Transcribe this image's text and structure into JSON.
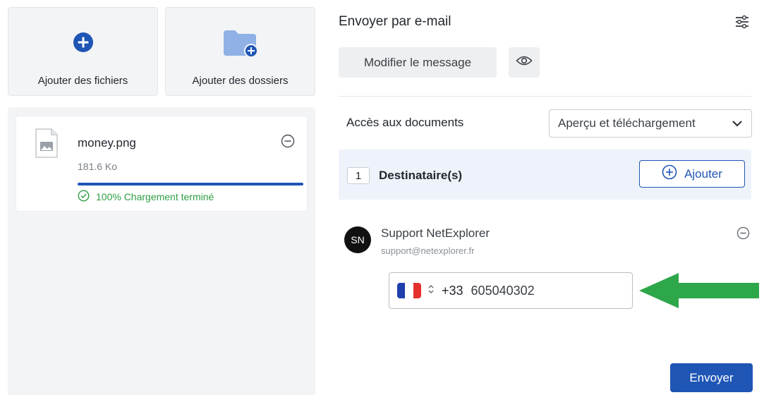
{
  "left": {
    "tiles": [
      {
        "label": "Ajouter des fichiers",
        "icon": "plus-circle-icon"
      },
      {
        "label": "Ajouter des dossiers",
        "icon": "folder-add-icon"
      }
    ],
    "file": {
      "name": "money.png",
      "size": "181.6 Ko",
      "progress": 1.0,
      "status": "100% Chargement terminé",
      "thumbnail_icon": "image-file-icon",
      "remove_icon": "minus-circle-icon"
    }
  },
  "right": {
    "title": "Envoyer par e-mail",
    "settings_icon": "sliders-icon",
    "edit_message_label": "Modifier le message",
    "preview_icon": "eye-icon",
    "access": {
      "label": "Accès aux documents",
      "selected": "Aperçu et téléchargement"
    },
    "recipients": {
      "count": "1",
      "label": "Destinataire(s)",
      "add_label": "Ajouter"
    },
    "recipient": {
      "initials": "SN",
      "name": "Support NetExplorer",
      "email": "support@netexplorer.fr",
      "phone_prefix": "+33",
      "phone_number": "605040302",
      "country_flag": "france-flag"
    },
    "send_label": "Envoyer"
  },
  "colors": {
    "primary": "#1f56b5",
    "success": "#2f9e44",
    "annotation_arrow": "#2ea64a",
    "panel_bg": "#f3f4f6"
  }
}
